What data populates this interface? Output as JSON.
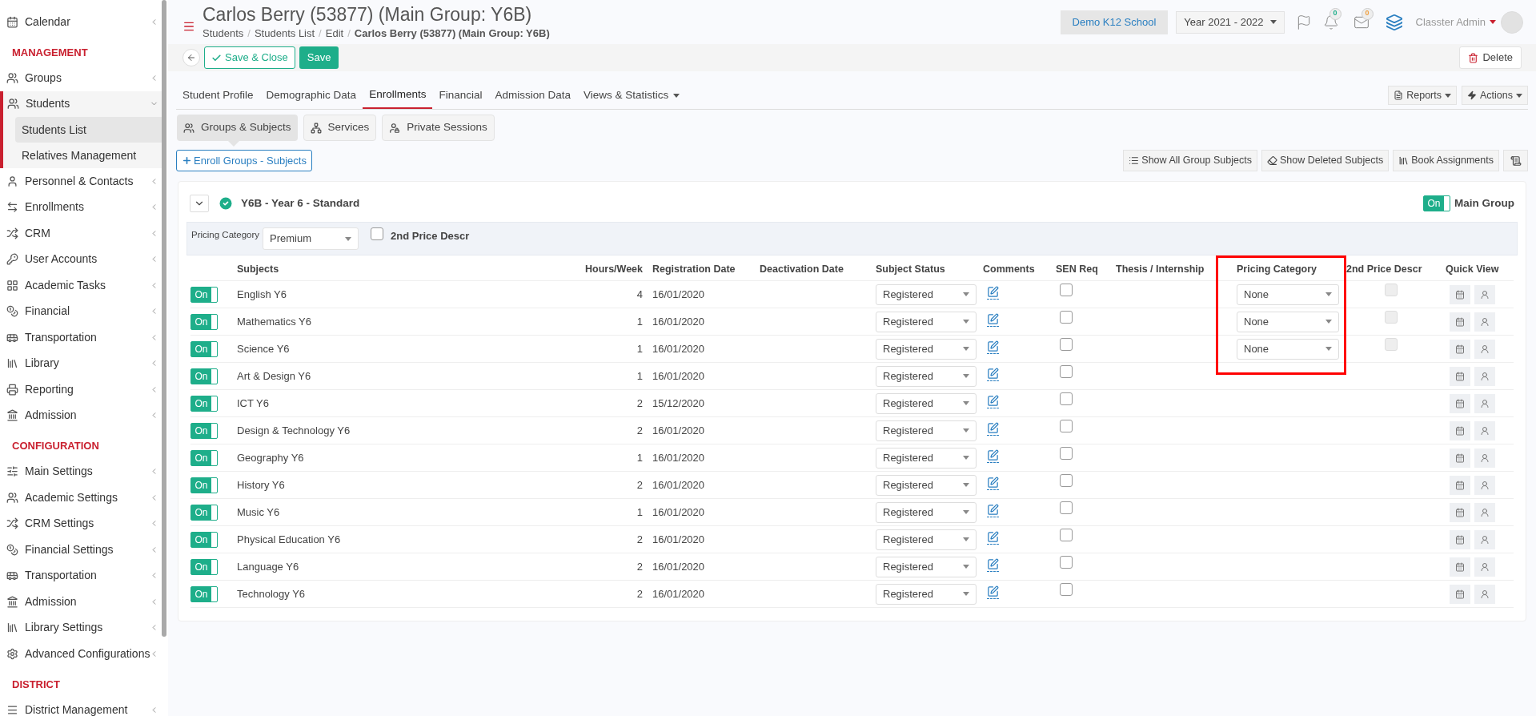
{
  "sidebar": {
    "sections": [
      {
        "items": [
          {
            "label": "Calendar",
            "expanded": false
          }
        ]
      },
      {
        "heading": "MANAGEMENT",
        "items": [
          {
            "label": "Groups",
            "expanded": false
          },
          {
            "label": "Students",
            "expanded": true,
            "children": [
              {
                "label": "Students List",
                "selected": true
              },
              {
                "label": "Relatives Management",
                "selected": false
              }
            ]
          },
          {
            "label": "Personnel & Contacts",
            "expanded": false
          },
          {
            "label": "Enrollments",
            "expanded": false
          },
          {
            "label": "CRM",
            "expanded": false
          },
          {
            "label": "User Accounts",
            "expanded": false
          },
          {
            "label": "Academic Tasks",
            "expanded": false
          },
          {
            "label": "Financial",
            "expanded": false
          },
          {
            "label": "Transportation",
            "expanded": false
          },
          {
            "label": "Library",
            "expanded": false
          },
          {
            "label": "Reporting",
            "expanded": false
          },
          {
            "label": "Admission",
            "expanded": false
          }
        ]
      },
      {
        "heading": "CONFIGURATION",
        "items": [
          {
            "label": "Main Settings",
            "expanded": false
          },
          {
            "label": "Academic Settings",
            "expanded": false
          },
          {
            "label": "CRM Settings",
            "expanded": false
          },
          {
            "label": "Financial Settings",
            "expanded": false
          },
          {
            "label": "Transportation",
            "expanded": false
          },
          {
            "label": "Admission",
            "expanded": false
          },
          {
            "label": "Library Settings",
            "expanded": false
          },
          {
            "label": "Advanced Configurations",
            "expanded": false
          }
        ]
      },
      {
        "heading": "DISTRICT",
        "items": [
          {
            "label": "District Management",
            "expanded": false
          }
        ]
      }
    ]
  },
  "header": {
    "title": "Carlos Berry (53877) (Main Group: Y6B)",
    "breadcrumbs": [
      "Students",
      "Students List",
      "Edit",
      "Carlos Berry (53877) (Main Group: Y6B)"
    ],
    "breadcrumb_separators": [
      "/",
      "/",
      "/"
    ],
    "school": "Demo K12 School",
    "year": "Year 2021 - 2022",
    "notifications": "0",
    "messages": "0",
    "user": "Classter Admin"
  },
  "toolbar": {
    "save_close": "Save & Close",
    "save": "Save",
    "delete": "Delete"
  },
  "tabs": [
    {
      "label": "Student Profile",
      "selected": false,
      "dropdown": false
    },
    {
      "label": "Demographic Data",
      "selected": false,
      "dropdown": false
    },
    {
      "label": "Enrollments",
      "selected": true,
      "dropdown": false
    },
    {
      "label": "Financial",
      "selected": false,
      "dropdown": false
    },
    {
      "label": "Admission Data",
      "selected": false,
      "dropdown": false
    },
    {
      "label": "Views & Statistics",
      "selected": false,
      "dropdown": true
    }
  ],
  "tab_actions": [
    "Reports",
    "Actions"
  ],
  "subtabs": [
    {
      "label": "Groups & Subjects",
      "selected": true
    },
    {
      "label": "Services",
      "selected": false
    },
    {
      "label": "Private Sessions",
      "selected": false
    }
  ],
  "enroll_button": "Enroll Groups - Subjects",
  "list_actions": [
    "Show All Group Subjects",
    "Show Deleted Subjects",
    "Book Assignments"
  ],
  "group": {
    "title": "Y6B - Year 6 - Standard",
    "expanded": true,
    "main_group": {
      "label": "Main Group",
      "on": true,
      "toggle": "On"
    },
    "pricing_label": "Pricing Category",
    "pricing_value": "Premium",
    "second_price": {
      "label": "2nd Price Descr",
      "checked": false
    }
  },
  "table": {
    "columns": [
      {
        "label": "Subjects"
      },
      {
        "label": "Hours/Week"
      },
      {
        "label": "Registration Date"
      },
      {
        "label": "Deactivation Date"
      },
      {
        "label": "Subject Status"
      },
      {
        "label": "Comments"
      },
      {
        "label": "SEN Req"
      },
      {
        "label": "Thesis / Internship"
      },
      {
        "label": "Pricing Category",
        "highlighted": true
      },
      {
        "label": "2nd Price Descr"
      },
      {
        "label": "Quick View"
      }
    ],
    "rows": [
      {
        "on": true,
        "toggle": "On",
        "subject": "English Y6",
        "hours": "4",
        "registration": "16/01/2020",
        "status": "Registered",
        "sen": false,
        "pricing": "None",
        "second_price": false
      },
      {
        "on": true,
        "toggle": "On",
        "subject": "Mathematics Y6",
        "hours": "1",
        "registration": "16/01/2020",
        "status": "Registered",
        "sen": false,
        "pricing": "None",
        "second_price": false
      },
      {
        "on": true,
        "toggle": "On",
        "subject": "Science Y6",
        "hours": "1",
        "registration": "16/01/2020",
        "status": "Registered",
        "sen": false,
        "pricing": "None",
        "second_price": false
      },
      {
        "on": true,
        "toggle": "On",
        "subject": "Art & Design Y6",
        "hours": "1",
        "registration": "16/01/2020",
        "status": "Registered",
        "sen": false
      },
      {
        "on": true,
        "toggle": "On",
        "subject": "ICT Y6",
        "hours": "2",
        "registration": "15/12/2020",
        "status": "Registered",
        "sen": false
      },
      {
        "on": true,
        "toggle": "On",
        "subject": "Design & Technology Y6",
        "hours": "2",
        "registration": "16/01/2020",
        "status": "Registered",
        "sen": false
      },
      {
        "on": true,
        "toggle": "On",
        "subject": "Geography Y6",
        "hours": "1",
        "registration": "16/01/2020",
        "status": "Registered",
        "sen": false
      },
      {
        "on": true,
        "toggle": "On",
        "subject": "History Y6",
        "hours": "2",
        "registration": "16/01/2020",
        "status": "Registered",
        "sen": false
      },
      {
        "on": true,
        "toggle": "On",
        "subject": "Music Y6",
        "hours": "1",
        "registration": "16/01/2020",
        "status": "Registered",
        "sen": false
      },
      {
        "on": true,
        "toggle": "On",
        "subject": "Physical Education Y6",
        "hours": "2",
        "registration": "16/01/2020",
        "status": "Registered",
        "sen": false
      },
      {
        "on": true,
        "toggle": "On",
        "subject": "Language Y6",
        "hours": "2",
        "registration": "16/01/2020",
        "status": "Registered",
        "sen": false
      },
      {
        "on": true,
        "toggle": "On",
        "subject": "Technology Y6",
        "hours": "2",
        "registration": "16/01/2020",
        "status": "Registered",
        "sen": false
      }
    ]
  }
}
